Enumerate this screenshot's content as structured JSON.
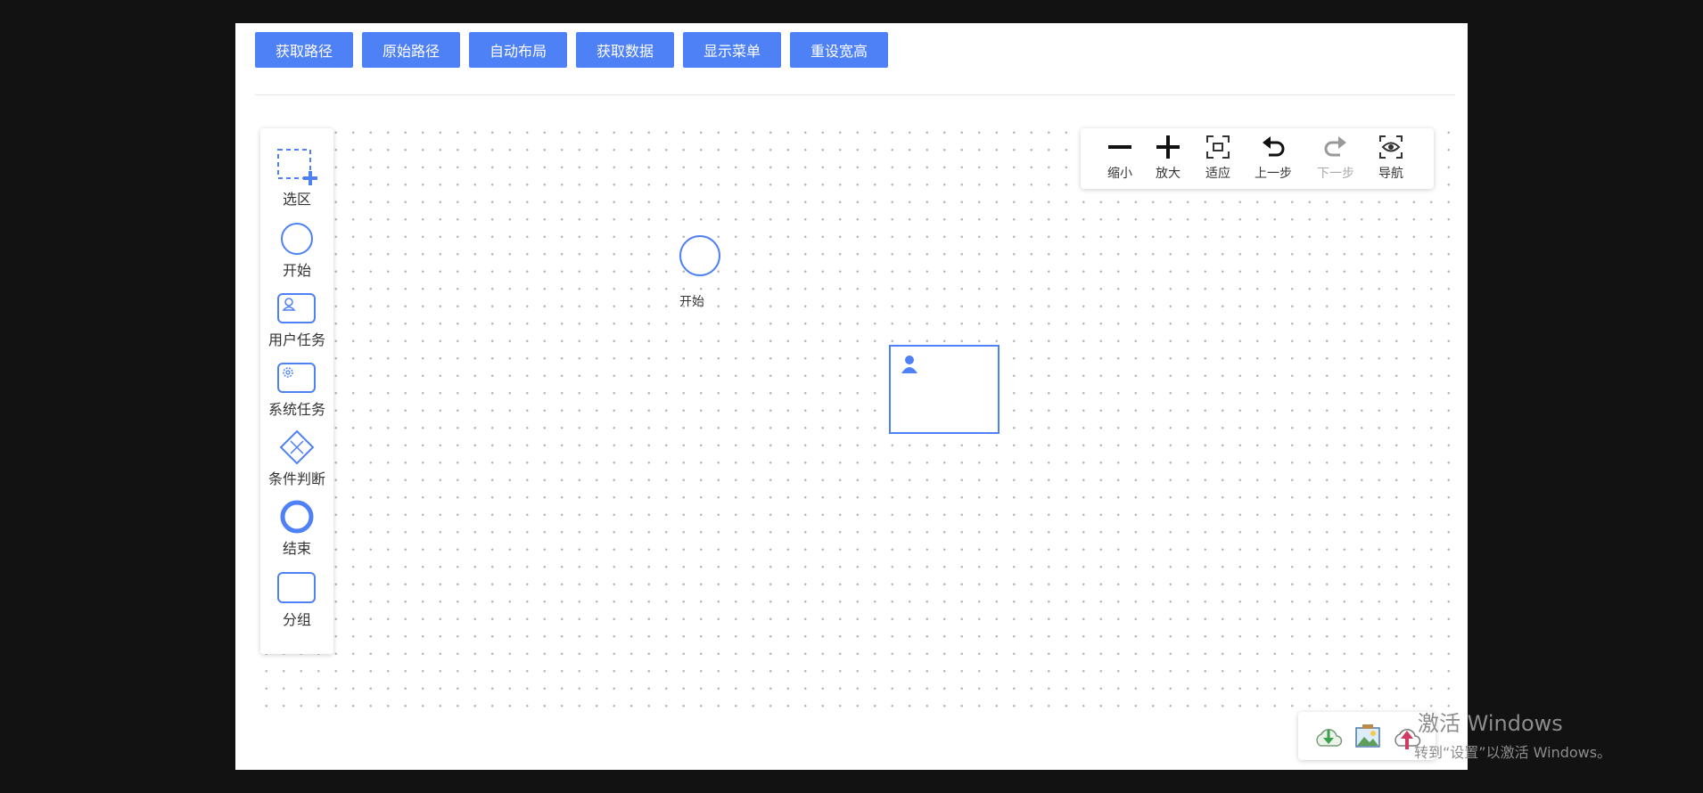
{
  "toolbar": {
    "buttons": [
      "获取路径",
      "原始路径",
      "自动布局",
      "获取数据",
      "显示菜单",
      "重设宽高"
    ]
  },
  "palette": {
    "items": [
      {
        "label": "选区",
        "icon": "selection-icon"
      },
      {
        "label": "开始",
        "icon": "start-event-icon"
      },
      {
        "label": "用户任务",
        "icon": "user-task-icon"
      },
      {
        "label": "系统任务",
        "icon": "system-task-icon"
      },
      {
        "label": "条件判断",
        "icon": "gateway-icon"
      },
      {
        "label": "结束",
        "icon": "end-event-icon"
      },
      {
        "label": "分组",
        "icon": "group-icon"
      }
    ]
  },
  "controls": {
    "items": [
      {
        "label": "缩小",
        "icon": "zoom-out-icon",
        "enabled": true
      },
      {
        "label": "放大",
        "icon": "zoom-in-icon",
        "enabled": true
      },
      {
        "label": "适应",
        "icon": "fit-icon",
        "enabled": true
      },
      {
        "label": "上一步",
        "icon": "undo-icon",
        "enabled": true
      },
      {
        "label": "下一步",
        "icon": "redo-icon",
        "enabled": false
      },
      {
        "label": "导航",
        "icon": "minimap-icon",
        "enabled": true
      }
    ]
  },
  "canvas": {
    "start_node_label": "开始"
  },
  "export": {
    "icons": [
      "download-icon",
      "image-icon",
      "upload-icon"
    ]
  },
  "watermark": {
    "line1": "激活 Windows",
    "line2": "转到“设置”以激活 Windows。"
  },
  "colors": {
    "primary": "#4e80f6",
    "background": "#121212"
  }
}
